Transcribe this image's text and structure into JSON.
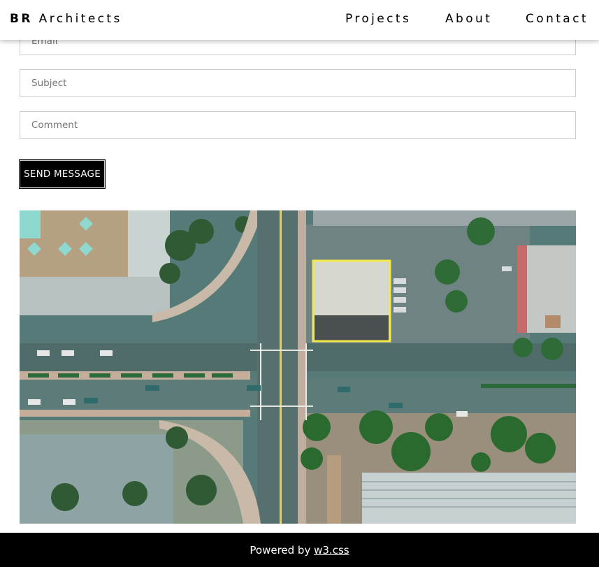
{
  "header": {
    "brand_bold": "BR",
    "brand_rest": "Architects",
    "nav": {
      "projects": "Projects",
      "about": "About",
      "contact": "Contact"
    }
  },
  "form": {
    "email_placeholder": "Email",
    "subject_placeholder": "Subject",
    "comment_placeholder": "Comment",
    "send_label": "SEND MESSAGE"
  },
  "image": {
    "subject": "aerial-view-of-city-intersection"
  },
  "footer": {
    "prefix": "Powered by",
    "link_text": "w3.css"
  },
  "colors": {
    "nav_text": "#000000",
    "button_bg": "#000000",
    "footer_bg": "#000000",
    "highlight": "#f2e84a"
  }
}
